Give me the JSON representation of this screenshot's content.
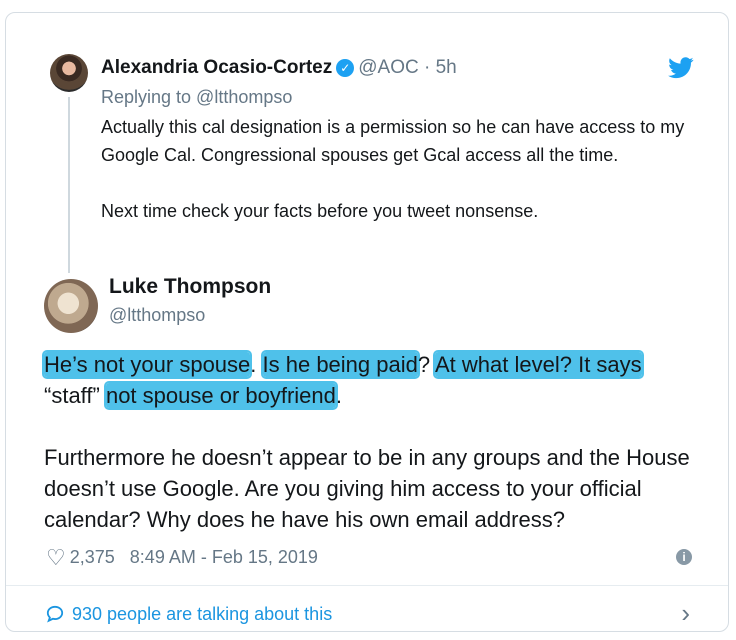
{
  "reply_tweet": {
    "author_name": "Alexandria Ocasio-Cortez",
    "handle_time": "@AOC · 5h",
    "replying_to": "Replying to @ltthompso",
    "text_1": "Actually this cal designation is a permission so he can have access to my Google Cal. Congressional spouses get Gcal access all the time.",
    "text_2": "Next time check your facts before you tweet nonsense."
  },
  "main_tweet": {
    "author_name": "Luke Thompson",
    "handle": "@ltthompso",
    "p1_segments": {
      "s1": "He’s not your spouse",
      "s2": ". ",
      "s3": "Is he being paid",
      "s4": "? ",
      "s5": "At what level? It says",
      "s6": "“staff” ",
      "s7": "not spouse or boyfriend",
      "s8": "."
    },
    "paragraph_2": "Furthermore he doesn’t appear to be in any groups and the House doesn’t use Google. Are you giving him access to your official calendar? Why does he have his own email address?",
    "likes": "2,375",
    "timestamp": "8:49 AM - Feb 15, 2019"
  },
  "footer": {
    "talking": "930 people are talking about this"
  },
  "icons": {
    "verified": "verified-badge-icon",
    "bird": "twitter-bird-icon",
    "heart": "heart-icon",
    "info": "info-icon",
    "comment": "comment-bubble-icon",
    "chevron": "chevron-right-icon"
  },
  "colors": {
    "twitter_blue": "#1da1f2",
    "highlight": "#4fc1ea",
    "muted": "#657786"
  }
}
